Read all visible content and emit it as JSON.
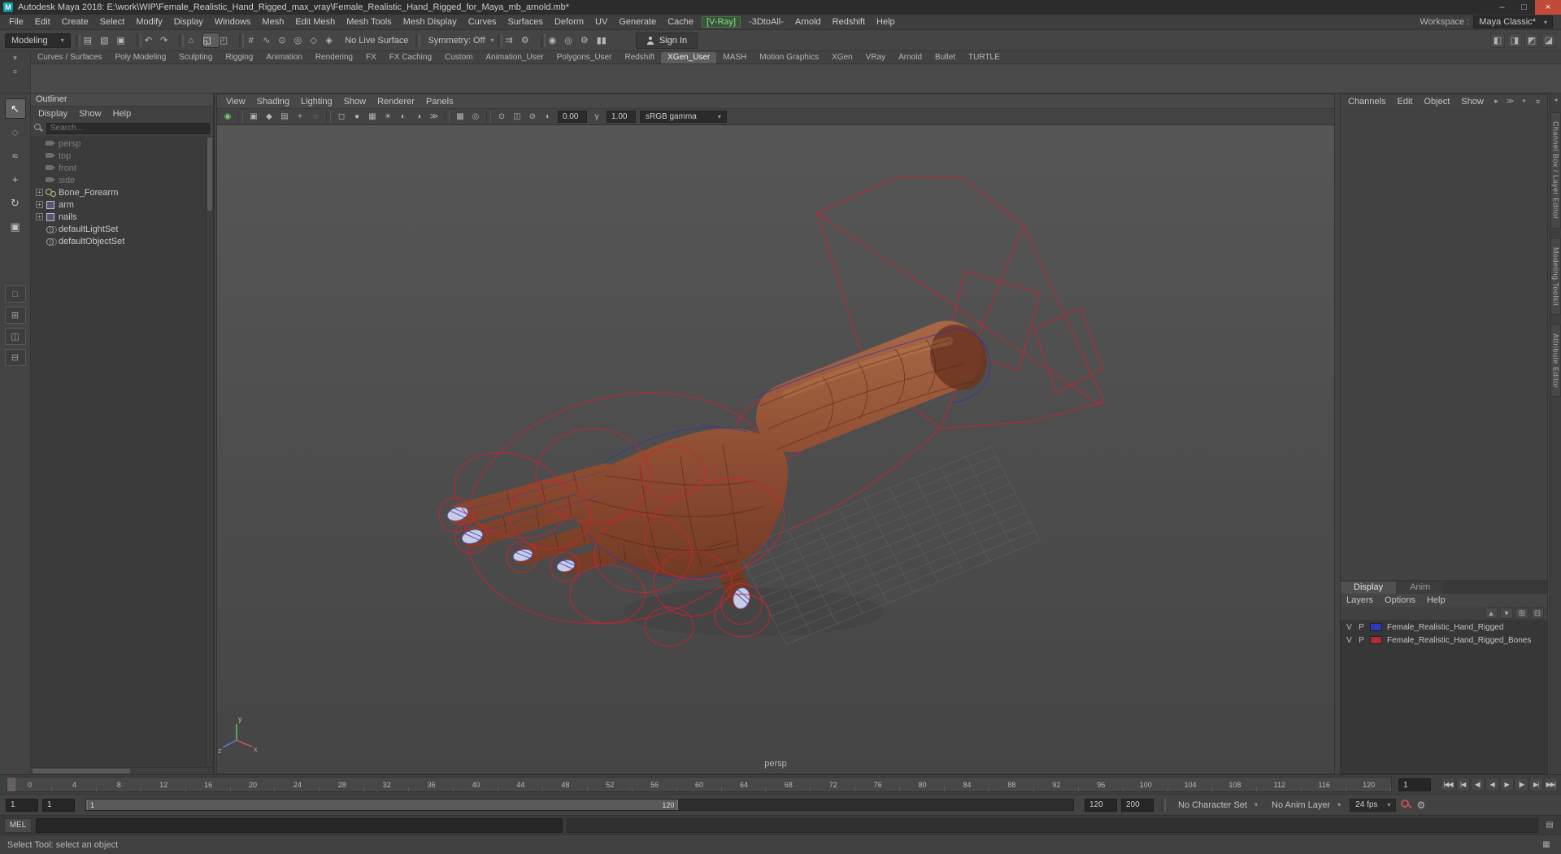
{
  "colors": {
    "rig": "#cf2430",
    "accent_green": "#7fe57f",
    "status_green": "#6fcf6f",
    "wire_dark": "#471f12",
    "wire_blue": "#3434b0",
    "nail": "#c9cde8"
  },
  "window": {
    "title": "Autodesk Maya 2018: E:\\work\\WIP\\Female_Realistic_Hand_Rigged_max_vray\\Female_Realistic_Hand_Rigged_for_Maya_mb_arnold.mb*",
    "minimize_glyph": "–",
    "maximize_glyph": "□",
    "close_glyph": "×"
  },
  "menubar": {
    "items": [
      {
        "n": "menu-file",
        "label": "File"
      },
      {
        "n": "menu-edit",
        "label": "Edit"
      },
      {
        "n": "menu-create",
        "label": "Create"
      },
      {
        "n": "menu-select",
        "label": "Select"
      },
      {
        "n": "menu-modify",
        "label": "Modify"
      },
      {
        "n": "menu-display",
        "label": "Display"
      },
      {
        "n": "menu-windows",
        "label": "Windows"
      },
      {
        "n": "menu-mesh",
        "label": "Mesh"
      },
      {
        "n": "menu-edit-mesh",
        "label": "Edit Mesh"
      },
      {
        "n": "menu-mesh-tools",
        "label": "Mesh Tools"
      },
      {
        "n": "menu-mesh-display",
        "label": "Mesh Display"
      },
      {
        "n": "menu-curves",
        "label": "Curves"
      },
      {
        "n": "menu-surfaces",
        "label": "Surfaces"
      },
      {
        "n": "menu-deform",
        "label": "Deform"
      },
      {
        "n": "menu-uv",
        "label": "UV"
      },
      {
        "n": "menu-generate",
        "label": "Generate"
      },
      {
        "n": "menu-cache",
        "label": "Cache"
      },
      {
        "n": "menu-vray",
        "label": "[V-Ray]",
        "accent": true
      },
      {
        "n": "menu-3dtoall",
        "label": "-3DtoAll-"
      },
      {
        "n": "menu-arnold",
        "label": "Arnold"
      },
      {
        "n": "menu-redshift",
        "label": "Redshift"
      },
      {
        "n": "menu-help",
        "label": "Help"
      }
    ],
    "workspace_label": "Workspace :",
    "workspace_value": "Maya Classic*"
  },
  "statusline": {
    "mode": "Modeling",
    "items": [
      {
        "name": "separator",
        "glyph": "",
        "sep": true,
        "i": "false"
      },
      {
        "name": "new-scene-icon",
        "glyph": "▤"
      },
      {
        "name": "open-scene-icon",
        "glyph": "▧"
      },
      {
        "name": "save-scene-icon",
        "glyph": "▣"
      },
      {
        "name": "separator",
        "glyph": "",
        "sep": true,
        "i": "false"
      },
      {
        "name": "undo-icon",
        "glyph": "↶"
      },
      {
        "name": "redo-icon",
        "glyph": "↷"
      },
      {
        "name": "separator",
        "glyph": "",
        "sep": true,
        "i": "false"
      },
      {
        "name": "select-hierarchy-icon",
        "glyph": "⌂"
      },
      {
        "name": "select-object-icon",
        "glyph": "◱",
        "active": true
      },
      {
        "name": "select-component-icon",
        "glyph": "◰"
      },
      {
        "name": "separator",
        "glyph": "",
        "sep": true,
        "i": "false"
      },
      {
        "name": "snap-to-grid-icon",
        "glyph": "#"
      },
      {
        "name": "snap-to-curve-icon",
        "glyph": "∿"
      },
      {
        "name": "snap-to-point-icon",
        "glyph": "⊙"
      },
      {
        "name": "snap-to-projected-center-icon",
        "glyph": "◎"
      },
      {
        "name": "snap-to-view-plane-icon",
        "glyph": "◇"
      },
      {
        "name": "make-live-icon",
        "glyph": "◈"
      },
      {
        "name": "no-live-surface-label",
        "label": "No Live Surface",
        "text": true,
        "i": "false"
      },
      {
        "name": "separator",
        "glyph": "",
        "sep": true,
        "i": "false"
      },
      {
        "name": "symmetry-dropdown",
        "label": "Symmetry: Off",
        "text": true,
        "arrow": true
      },
      {
        "name": "separator",
        "glyph": "",
        "sep": true,
        "i": "false"
      },
      {
        "name": "input-connections-icon",
        "glyph": "⇉"
      },
      {
        "name": "construction-history-icon",
        "glyph": "⚙"
      },
      {
        "name": "separator",
        "glyph": "",
        "sep": true,
        "i": "false"
      },
      {
        "name": "render-current-frame-icon",
        "glyph": "◉"
      },
      {
        "name": "ipr-render-icon",
        "glyph": "◎"
      },
      {
        "name": "render-settings-icon",
        "glyph": "⚙"
      },
      {
        "name": "pause-evaluation-icon",
        "glyph": "▮▮"
      }
    ],
    "sign_in": "Sign In",
    "toggles": [
      {
        "name": "toggle-attribute-editor-icon",
        "glyph": "◧"
      },
      {
        "name": "toggle-tool-settings-icon",
        "glyph": "◨"
      },
      {
        "name": "toggle-channel-box-icon",
        "glyph": "◩"
      },
      {
        "name": "toggle-modeling-toolkit-icon",
        "glyph": "◪"
      }
    ]
  },
  "shelf": {
    "menu_icons": [
      {
        "name": "shelf-tab-options-icon",
        "glyph": "▾"
      },
      {
        "name": "shelf-menu-icon",
        "glyph": "≡"
      }
    ],
    "tabs": [
      {
        "n": "shelf-tab-curves-surfaces",
        "label": "Curves / Surfaces"
      },
      {
        "n": "shelf-tab-poly-modeling",
        "label": "Poly Modeling"
      },
      {
        "n": "shelf-tab-sculpting",
        "label": "Sculpting"
      },
      {
        "n": "shelf-tab-rigging",
        "label": "Rigging"
      },
      {
        "n": "shelf-tab-animation",
        "label": "Animation"
      },
      {
        "n": "shelf-tab-rendering",
        "label": "Rendering"
      },
      {
        "n": "shelf-tab-fx",
        "label": "FX"
      },
      {
        "n": "shelf-tab-fx-caching",
        "label": "FX Caching"
      },
      {
        "n": "shelf-tab-custom",
        "label": "Custom"
      },
      {
        "n": "shelf-tab-animation-user",
        "label": "Animation_User"
      },
      {
        "n": "shelf-tab-polygons-user",
        "label": "Polygons_User"
      },
      {
        "n": "shelf-tab-redshift",
        "label": "Redshift"
      },
      {
        "n": "shelf-tab-xgen-user",
        "label": "XGen_User",
        "active": true
      },
      {
        "n": "shelf-tab-mash",
        "label": "MASH"
      },
      {
        "n": "shelf-tab-motion-graphics",
        "label": "Motion Graphics"
      },
      {
        "n": "shelf-tab-xgen",
        "label": "XGen"
      },
      {
        "n": "shelf-tab-vray",
        "label": "VRay"
      },
      {
        "n": "shelf-tab-arnold",
        "label": "Arnold"
      },
      {
        "n": "shelf-tab-bullet",
        "label": "Bullet"
      },
      {
        "n": "shelf-tab-turtle",
        "label": "TURTLE"
      }
    ]
  },
  "toolbox": {
    "tools": [
      {
        "name": "select-tool",
        "glyph": "↖",
        "active": true
      },
      {
        "name": "lasso-select-tool",
        "glyph": "◌"
      },
      {
        "name": "paint-select-tool",
        "glyph": "≈"
      },
      {
        "name": "move-tool",
        "glyph": "+"
      },
      {
        "name": "rotate-tool",
        "glyph": "↻"
      },
      {
        "name": "scale-tool",
        "glyph": "▣"
      }
    ],
    "layouts": [
      {
        "name": "layout-single-pane",
        "glyph": "□"
      },
      {
        "name": "layout-four-pane",
        "glyph": "⊞"
      },
      {
        "name": "layout-persp-outliner",
        "glyph": "◫"
      },
      {
        "name": "layout-two-pane",
        "glyph": "⊟"
      }
    ]
  },
  "outliner": {
    "title": "Outliner",
    "menus": [
      "Display",
      "Show",
      "Help"
    ],
    "search_placeholder": "Search...",
    "items": [
      {
        "n": "outliner-item-persp",
        "label": "persp",
        "icon": "cam",
        "muted": true
      },
      {
        "n": "outliner-item-top",
        "label": "top",
        "icon": "cam",
        "muted": true
      },
      {
        "n": "outliner-item-front",
        "label": "front",
        "icon": "cam",
        "muted": true
      },
      {
        "n": "outliner-item-side",
        "label": "side",
        "icon": "cam",
        "muted": true
      },
      {
        "n": "outliner-item-bone-forearm",
        "label": "Bone_Forearm",
        "icon": "joint",
        "exp": true
      },
      {
        "n": "outliner-item-arm",
        "label": "arm",
        "icon": "mesh",
        "exp": true
      },
      {
        "n": "outliner-item-nails",
        "label": "nails",
        "icon": "mesh",
        "exp": true
      },
      {
        "n": "outliner-item-default-light-set",
        "label": "defaultLightSet",
        "icon": "set"
      },
      {
        "n": "outliner-item-default-object-set",
        "label": "defaultObjectSet",
        "icon": "set"
      }
    ]
  },
  "viewport": {
    "menus": [
      "View",
      "Shading",
      "Lighting",
      "Show",
      "Renderer",
      "Panels"
    ],
    "toolbar": [
      {
        "name": "renderer-status-icon",
        "glyph": "◉",
        "green": true
      },
      {
        "name": "toolbar-separator",
        "glyph": "",
        "sep": true,
        "i": "false"
      },
      {
        "name": "camera-attributes-icon",
        "glyph": "▣"
      },
      {
        "name": "bookmarks-icon",
        "glyph": "◆"
      },
      {
        "name": "image-plane-icon",
        "glyph": "▤"
      },
      {
        "name": "two-d-pan-zoom-icon",
        "glyph": "+"
      },
      {
        "name": "oversampling-icon",
        "glyph": "◌"
      },
      {
        "name": "toolbar-separator",
        "glyph": "",
        "sep": true,
        "i": "false"
      },
      {
        "name": "wireframe-icon",
        "glyph": "◻"
      },
      {
        "name": "smooth-shade-icon",
        "glyph": "●"
      },
      {
        "name": "textured-icon",
        "glyph": "▦"
      },
      {
        "name": "use-all-lights-icon",
        "glyph": "☀"
      },
      {
        "name": "shadows-icon",
        "glyph": "◐"
      },
      {
        "name": "screen-space-ao-icon",
        "glyph": "◑"
      },
      {
        "name": "motion-blur-icon",
        "glyph": "≫"
      },
      {
        "name": "toolbar-separator",
        "glyph": "",
        "sep": true,
        "i": "false"
      },
      {
        "name": "multisample-icon",
        "glyph": "▩"
      },
      {
        "name": "depth-of-field-icon",
        "glyph": "◎"
      },
      {
        "name": "toolbar-separator",
        "glyph": "",
        "sep": true,
        "i": "false"
      },
      {
        "name": "isolate-select-icon",
        "glyph": "⊙"
      },
      {
        "name": "xray-icon",
        "glyph": "◫"
      },
      {
        "name": "joints-xray-icon",
        "glyph": "⊘"
      },
      {
        "name": "exposure-icon",
        "glyph": "◐"
      }
    ],
    "exposure": "0.00",
    "gamma_icon": "γ",
    "gamma": "1.00",
    "view_transform": "sRGB gamma",
    "camera_label": "persp"
  },
  "channel_box": {
    "menus": [
      "Channels",
      "Edit",
      "Object",
      "Show"
    ],
    "corner_icons": [
      {
        "name": "channel-speed-slow-icon",
        "glyph": "▸"
      },
      {
        "name": "channel-speed-fast-icon",
        "glyph": "≫"
      },
      {
        "name": "channel-box-pin-icon",
        "glyph": "⌖"
      },
      {
        "name": "channel-box-menu-icon",
        "glyph": "≡"
      }
    ],
    "tabs": [
      {
        "n": "tab-display",
        "label": "Display",
        "active": true
      },
      {
        "n": "tab-anim",
        "label": "Anim"
      }
    ],
    "submenus": [
      "Layers",
      "Options",
      "Help"
    ],
    "layer_icons": [
      {
        "name": "layer-move-up-icon",
        "glyph": "▴"
      },
      {
        "name": "layer-move-down-icon",
        "glyph": "▾"
      },
      {
        "name": "new-empty-layer-icon",
        "glyph": "⊞"
      },
      {
        "name": "new-layer-from-selected-icon",
        "glyph": "⊟"
      }
    ],
    "layers": [
      {
        "visible": "V",
        "playback": "P",
        "color": "#2b3bbf",
        "name": "Female_Realistic_Hand_Rigged"
      },
      {
        "visible": "V",
        "playback": "P",
        "color": "#b02a3a",
        "name": "Female_Realistic_Hand_Rigged_Bones"
      }
    ]
  },
  "side_tabs": [
    "Channel Box / Layer Editor",
    "Modeling Toolkit",
    "Attribute Editor"
  ],
  "timeline": {
    "ticks": [
      "0",
      "4",
      "8",
      "12",
      "16",
      "20",
      "24",
      "28",
      "32",
      "36",
      "40",
      "44",
      "48",
      "52",
      "56",
      "60",
      "64",
      "68",
      "72",
      "76",
      "80",
      "84",
      "88",
      "92",
      "96",
      "100",
      "104",
      "108",
      "112",
      "116",
      "120"
    ],
    "current_frame": "1",
    "playback": [
      {
        "name": "go-to-start-button",
        "glyph": "|◀◀"
      },
      {
        "name": "step-back-frame-button",
        "glyph": "|◀"
      },
      {
        "name": "step-back-key-button",
        "glyph": "◀|"
      },
      {
        "name": "play-backwards-button",
        "glyph": "◀"
      },
      {
        "name": "play-forwards-button",
        "glyph": "▶"
      },
      {
        "name": "step-forward-key-button",
        "glyph": "|▶"
      },
      {
        "name": "step-forward-frame-button",
        "glyph": "▶|"
      },
      {
        "name": "go-to-end-button",
        "glyph": "▶▶|"
      }
    ]
  },
  "range_slider": {
    "anim_start": "1",
    "playback_start": "1",
    "range_start_label": "1",
    "range_end_label": "120",
    "playback_end": "120",
    "anim_end": "200",
    "character_set": "No Character Set",
    "anim_layer": "No Anim Layer",
    "fps": "24 fps"
  },
  "command_line": {
    "label": "MEL"
  },
  "help_line": {
    "text": "Select Tool: select an object"
  }
}
